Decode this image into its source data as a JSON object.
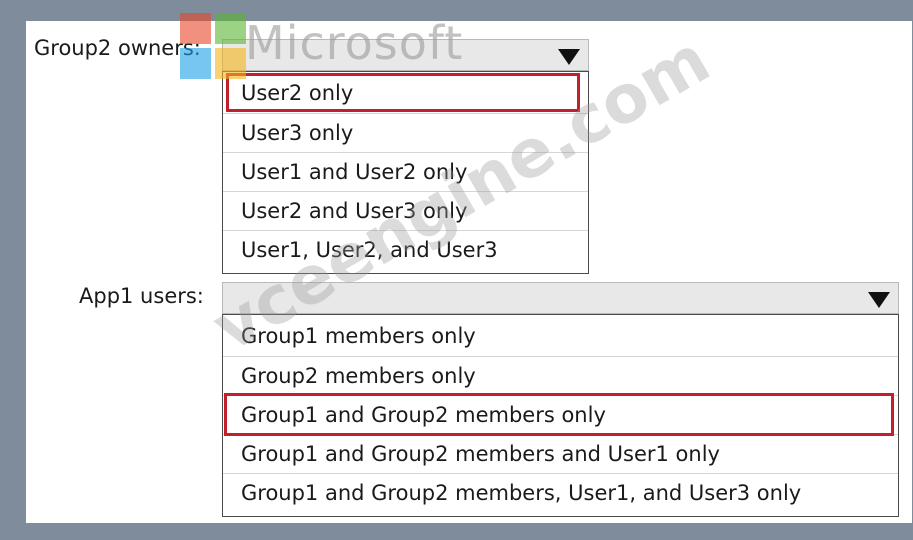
{
  "group2_owners": {
    "label": "Group2 owners:",
    "options": [
      "User2 only",
      "User3 only",
      "User1 and User2 only",
      "User2 and User3 only",
      "User1, User2, and User3"
    ]
  },
  "app1_users": {
    "label": "App1 users:",
    "options": [
      "Group1 members only",
      "Group2 members only",
      "Group1 and Group2 members only",
      "Group1 and Group2 members and User1 only",
      "Group1 and Group2 members, User1, and User3 only"
    ]
  },
  "watermark": {
    "logo_text": "Microsoft",
    "site_text": "vceengine.com"
  },
  "colors": {
    "highlight": "#c0202a",
    "frame": "#7f8c9c"
  }
}
